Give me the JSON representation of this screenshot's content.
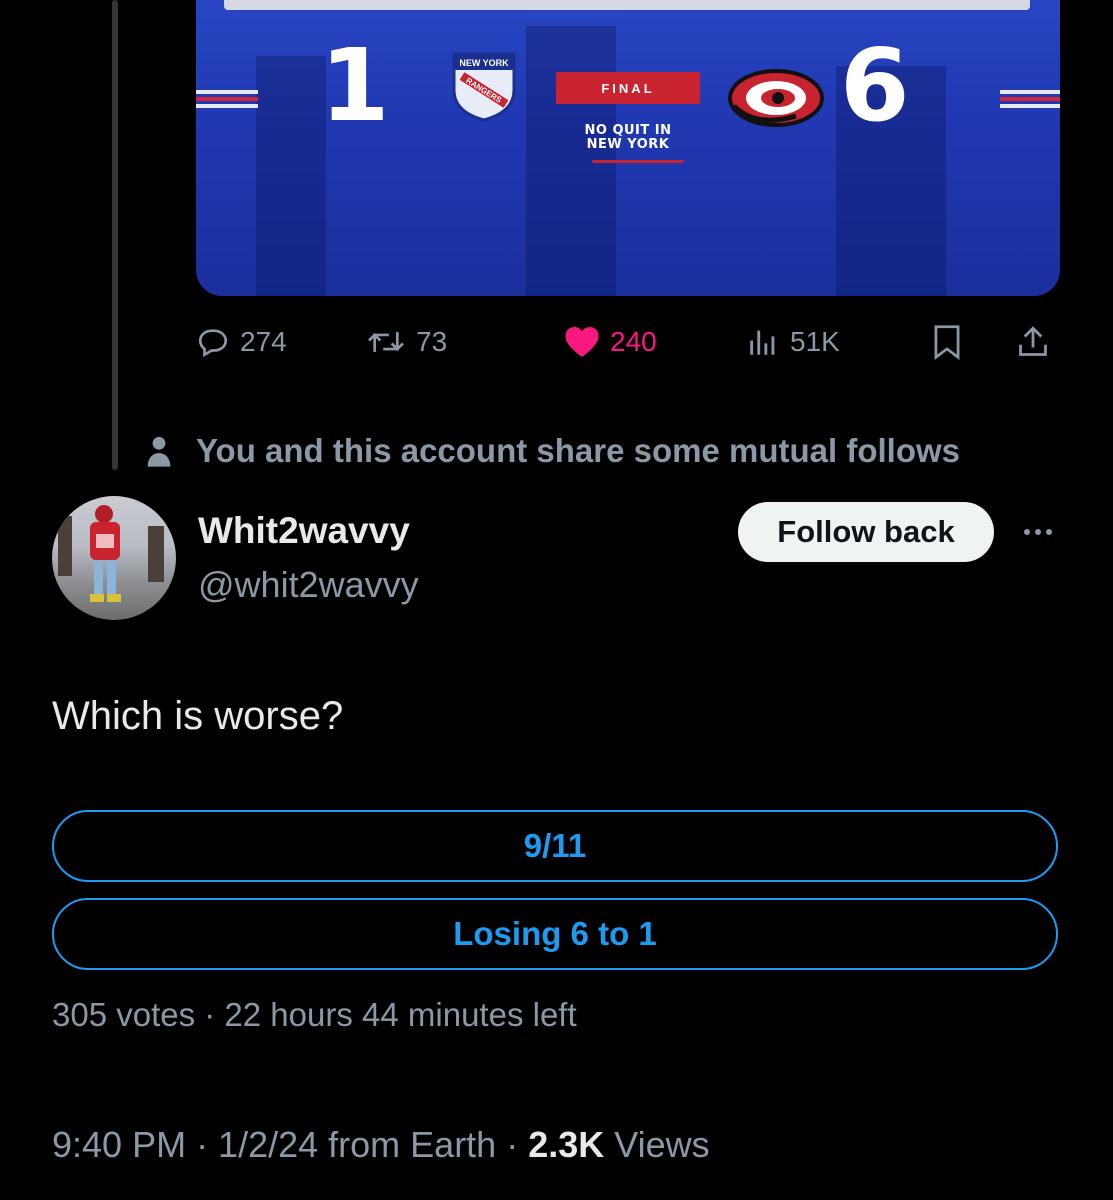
{
  "media": {
    "score_left": "1",
    "score_right": "6",
    "final_label": "FINAL",
    "tagline_line1": "NO QUIT IN",
    "tagline_line2": "NEW YORK",
    "rangers_logo_line1": "NEW YORK",
    "rangers_logo_line2": "RANGERS",
    "colors": {
      "blue": "#2038b2",
      "red": "#c8232e"
    }
  },
  "actions": {
    "replies": "274",
    "reposts": "73",
    "likes": "240",
    "views": "51K",
    "icons": [
      "reply-icon",
      "repost-icon",
      "heart-icon",
      "views-icon",
      "bookmark-icon",
      "share-icon"
    ]
  },
  "mutual": {
    "text": "You and this account share some mutual follows"
  },
  "author": {
    "display_name": "Whit2wavvy",
    "handle": "@whit2wavvy",
    "follow_label": "Follow back"
  },
  "post": {
    "text": "Which is worse?",
    "poll": {
      "options": [
        "9/11",
        "Losing 6 to 1"
      ],
      "meta": "305 votes · 22 hours 44 minutes left"
    },
    "time": "9:40 PM · 1/2/24 from Earth · ",
    "views_count": "2.3K",
    "views_label": " Views"
  },
  "theme": {
    "accent": "#1d9bf0",
    "like": "#f91880",
    "muted": "#8b98a5",
    "bg": "#000000"
  }
}
